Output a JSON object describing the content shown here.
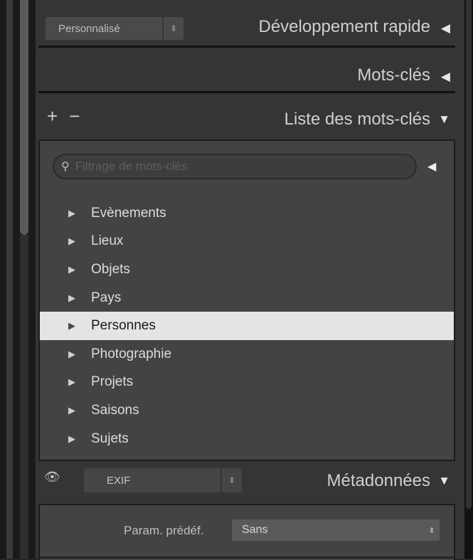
{
  "quick_develop": {
    "preset_value": "Personnalisé",
    "title": "Développement rapide"
  },
  "keywording": {
    "title": "Mots-clés"
  },
  "keyword_list": {
    "add_symbol": "+",
    "remove_symbol": "−",
    "title": "Liste des mots-clés",
    "search_placeholder": "Filtrage de mots-clés",
    "items": [
      {
        "label": "Evènements"
      },
      {
        "label": "Lieux"
      },
      {
        "label": "Objets"
      },
      {
        "label": "Pays"
      },
      {
        "label": "Personnes",
        "selected": true
      },
      {
        "label": "Photographie"
      },
      {
        "label": "Projets"
      },
      {
        "label": "Saisons"
      },
      {
        "label": "Sujets"
      }
    ]
  },
  "metadata": {
    "view_value": "EXIF",
    "title": "Métadonnées",
    "preset_label": "Param. prédéf.",
    "preset_value": "Sans"
  },
  "icons": {
    "collapsed": "triangle-left-icon",
    "expanded": "triangle-down-icon",
    "item": "triangle-right-icon",
    "search": "search-icon",
    "eye": "eye-icon"
  },
  "colors": {
    "panel_bg": "#353535",
    "list_bg": "#434343",
    "selected_row": "#e4e4e4",
    "text": "#d8d8d8"
  }
}
